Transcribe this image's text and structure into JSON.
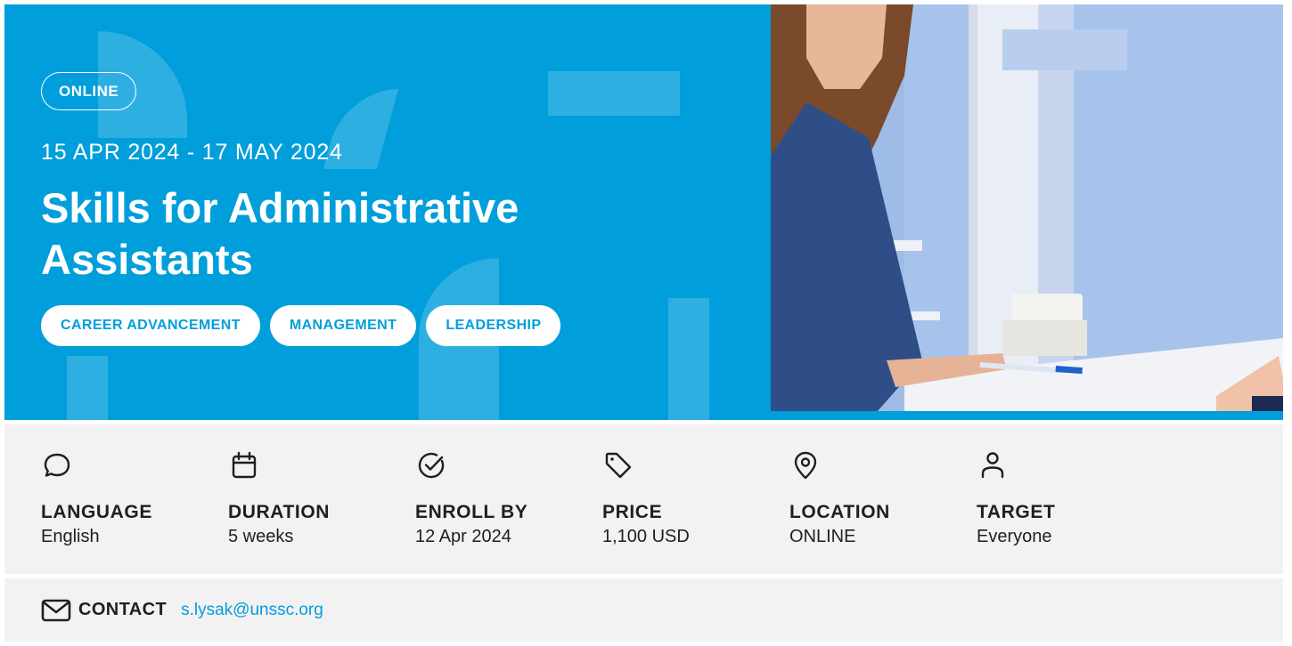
{
  "colors": {
    "accent": "#009edb",
    "panel": "#f2f2f2",
    "text": "#1f1f1f"
  },
  "hero": {
    "mode": "ONLINE",
    "dates": "15 APR 2024 - 17 MAY 2024",
    "title": "Skills for Administrative Assistants",
    "tags": [
      "CAREER ADVANCEMENT",
      "MANAGEMENT",
      "LEADERSHIP"
    ],
    "image_icon": "photo-two-people-at-desk"
  },
  "info": [
    {
      "icon": "chat-bubble-icon",
      "label": "LANGUAGE",
      "value": "English"
    },
    {
      "icon": "calendar-icon",
      "label": "DURATION",
      "value": "5 weeks"
    },
    {
      "icon": "check-circle-icon",
      "label": "ENROLL BY",
      "value": "12 Apr 2024"
    },
    {
      "icon": "price-tag-icon",
      "label": "PRICE",
      "value": "1,100 USD"
    },
    {
      "icon": "location-pin-icon",
      "label": "LOCATION",
      "value": "ONLINE"
    },
    {
      "icon": "person-icon",
      "label": "TARGET",
      "value": "Everyone"
    }
  ],
  "contact": {
    "icon": "mail-icon",
    "label": "CONTACT",
    "email": "s.lysak@unssc.org"
  }
}
